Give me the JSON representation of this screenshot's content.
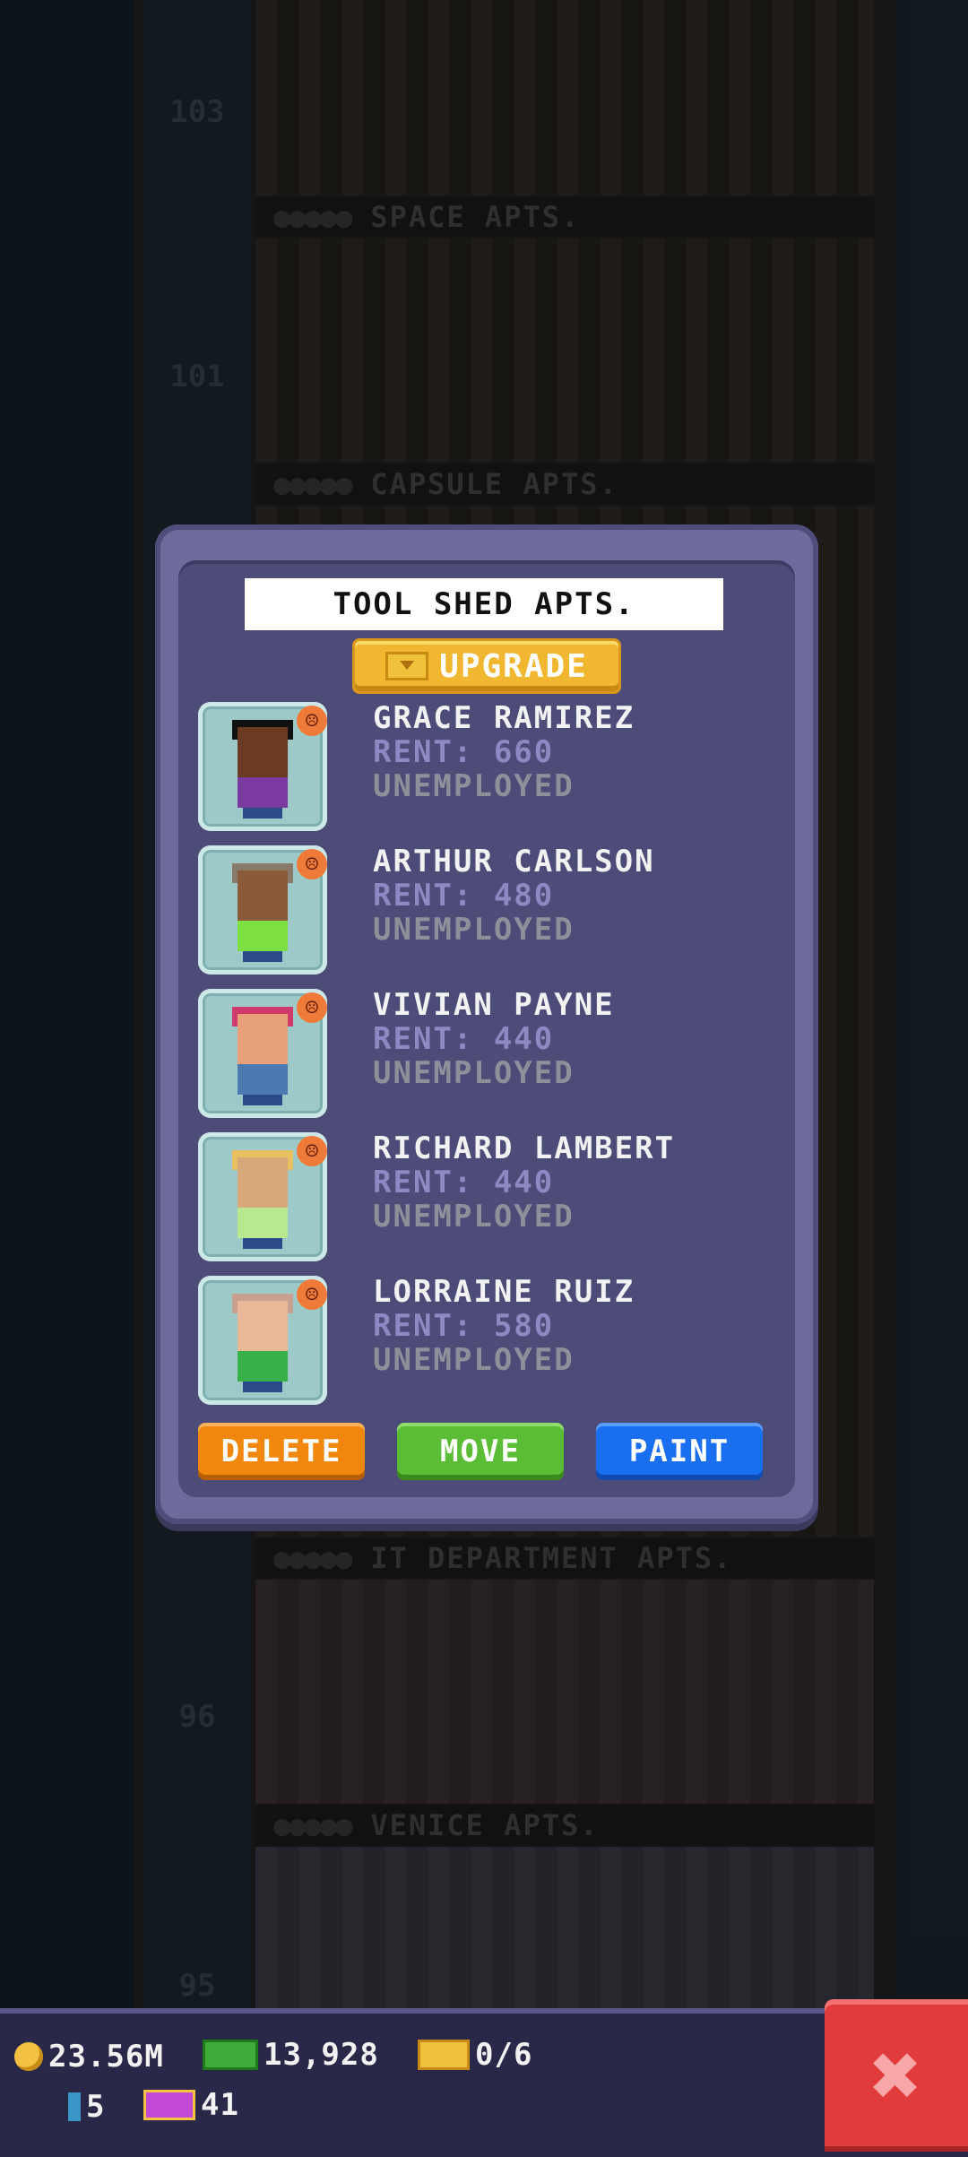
{
  "background": {
    "floors": [
      "103",
      "101",
      "96",
      "95"
    ],
    "room_labels": [
      {
        "stars": "●●●●●",
        "name": "SPACE APTS."
      },
      {
        "stars": "●●●●●",
        "name": "CAPSULE APTS."
      },
      {
        "stars": "●●●●●",
        "name": "IT DEPARTMENT APTS."
      },
      {
        "stars": "●●●●●",
        "name": "VENICE APTS."
      }
    ]
  },
  "dialog": {
    "title": "TOOL SHED APTS.",
    "upgrade_label": "UPGRADE",
    "residents": [
      {
        "name": "GRACE RAMIREZ",
        "rent": "RENT: 660",
        "job": "UNEMPLOYED",
        "mood": "☹",
        "skin": "#6b3a22",
        "shirt": "#7a3aa0",
        "hat": "#111111"
      },
      {
        "name": "ARTHUR CARLSON",
        "rent": "RENT: 480",
        "job": "UNEMPLOYED",
        "mood": "☹",
        "skin": "#8a5a3a",
        "shirt": "#7ce043",
        "hat": "#8a7a6a"
      },
      {
        "name": "VIVIAN PAYNE",
        "rent": "RENT: 440",
        "job": "UNEMPLOYED",
        "mood": "☹",
        "skin": "#e8a07a",
        "shirt": "#4a7ab0",
        "hat": "#d03a6a"
      },
      {
        "name": "RICHARD LAMBERT",
        "rent": "RENT: 440",
        "job": "UNEMPLOYED",
        "mood": "☹",
        "skin": "#d8a87a",
        "shirt": "#b8e890",
        "hat": "#e8c060"
      },
      {
        "name": "LORRAINE RUIZ",
        "rent": "RENT: 580",
        "job": "UNEMPLOYED",
        "mood": "☹",
        "skin": "#e8b898",
        "shirt": "#3ab04a",
        "hat": "#c8a090"
      }
    ],
    "delete_label": "DELETE",
    "move_label": "MOVE",
    "paint_label": "PAINT"
  },
  "bottom_bar": {
    "coins": "23.56M",
    "cash": "13,928",
    "bux": "0/6",
    "keys": "5",
    "vip": "41",
    "close_symbol": "✖"
  }
}
